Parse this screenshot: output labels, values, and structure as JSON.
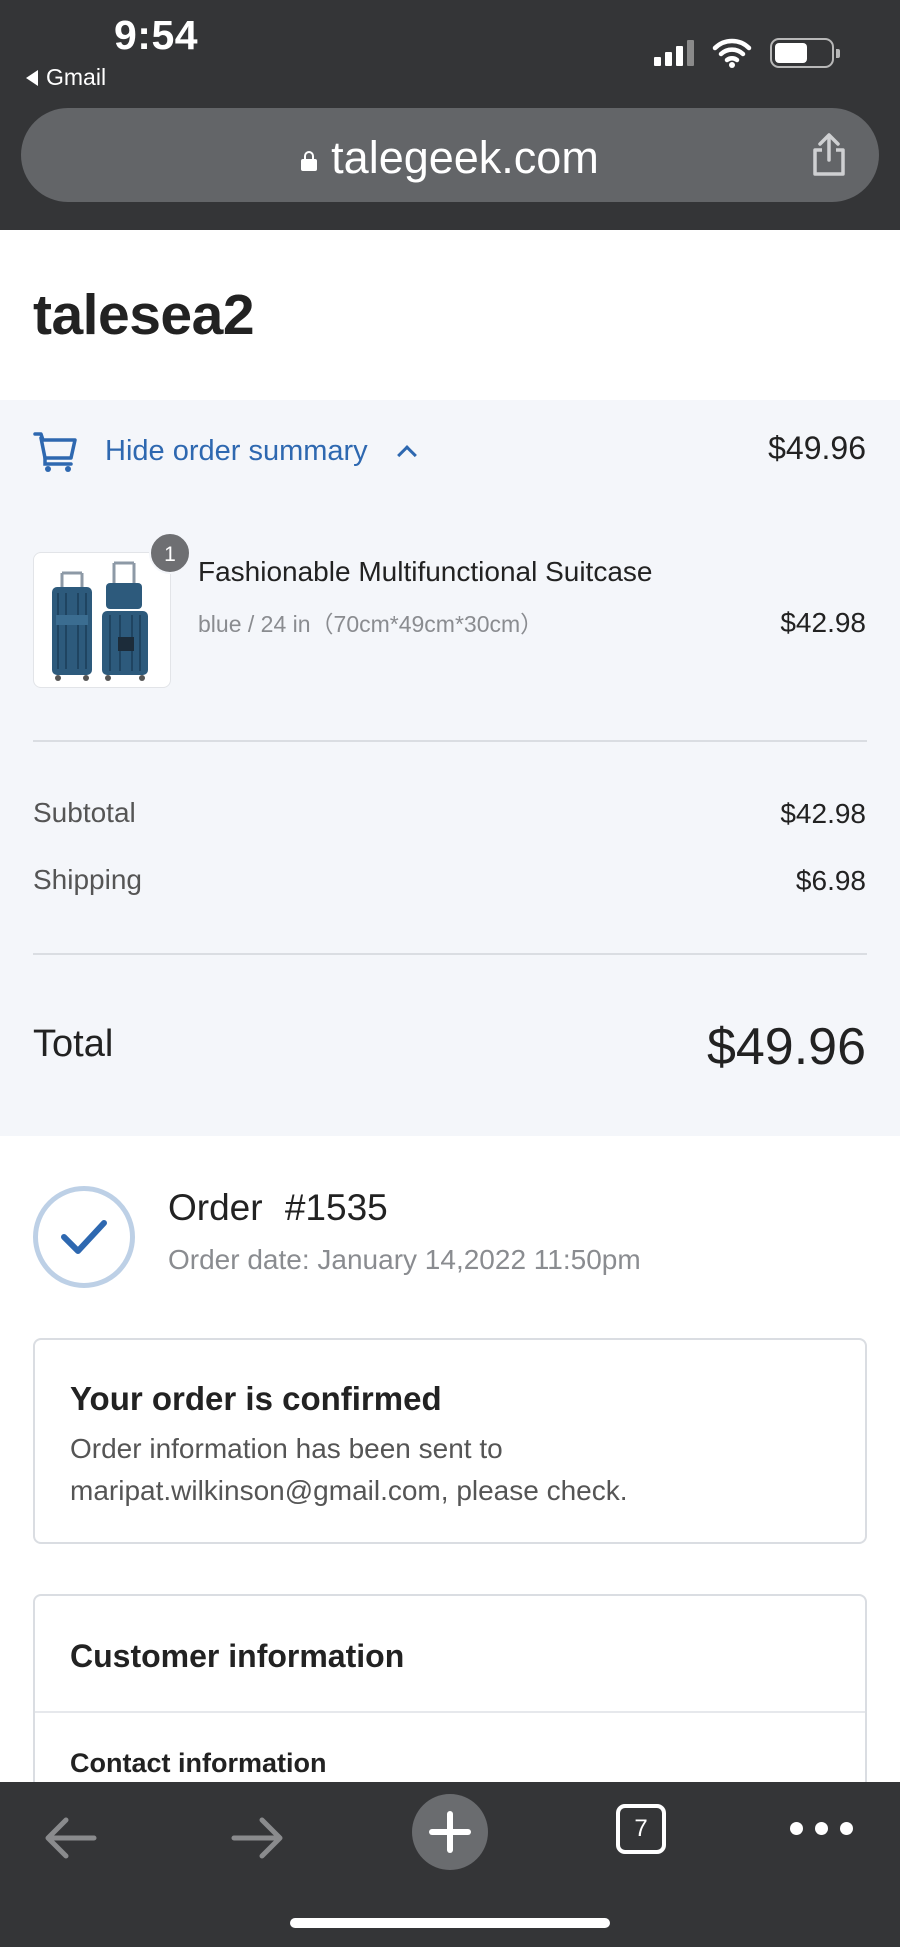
{
  "status_bar": {
    "time": "9:54",
    "back_app": "Gmail"
  },
  "browser": {
    "url": "talegeek.com",
    "tab_count": "7"
  },
  "store": {
    "name": "talesea2"
  },
  "summary": {
    "toggle_label": "Hide order summary",
    "total": "$49.96",
    "item": {
      "quantity": "1",
      "name": "Fashionable Multifunctional Suitcase",
      "variant": "blue / 24 in（70cm*49cm*30cm）",
      "price": "$42.98"
    },
    "subtotal_label": "Subtotal",
    "subtotal_value": "$42.98",
    "shipping_label": "Shipping",
    "shipping_value": "$6.98",
    "total_label": "Total",
    "total_value": "$49.96"
  },
  "order": {
    "title": "Order #1535",
    "date": "Order date:  January 14,2022 11:50pm"
  },
  "confirmation": {
    "title": "Your order is confirmed",
    "text": "Order information has been sent to maripat.wilkinson@gmail.com, please check."
  },
  "customer": {
    "title": "Customer information",
    "contact_title": "Contact information"
  },
  "colors": {
    "accent": "#2e68b0",
    "chrome": "#343537",
    "summary_bg": "#f4f6fa"
  }
}
